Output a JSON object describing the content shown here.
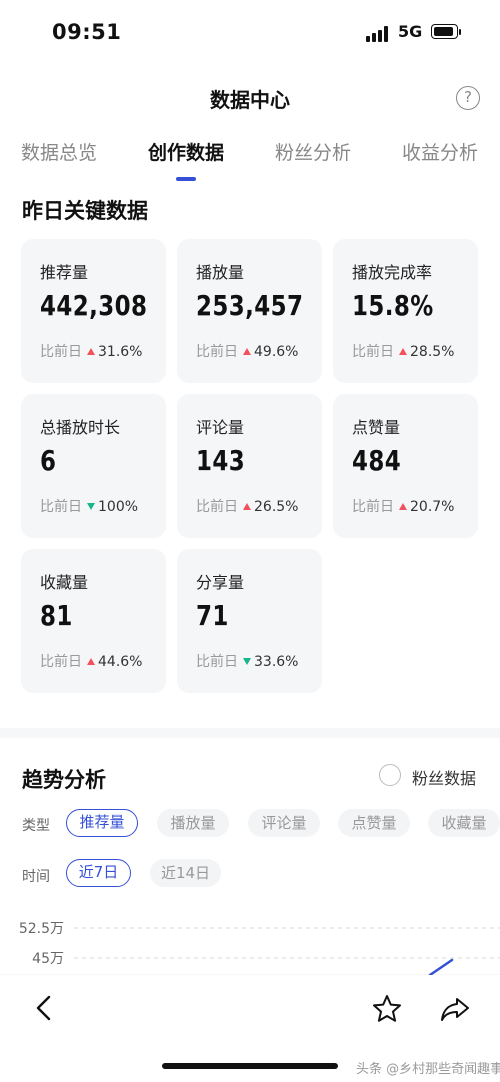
{
  "status_bar": {
    "time": "09:51",
    "network": "5G"
  },
  "header": {
    "title": "数据中心",
    "help_symbol": "?"
  },
  "tabs": [
    {
      "label": "数据总览"
    },
    {
      "label": "创作数据",
      "active": true
    },
    {
      "label": "粉丝分析"
    },
    {
      "label": "收益分析"
    }
  ],
  "section_title": "昨日关键数据",
  "compare_label": "比前日",
  "metrics": [
    {
      "label": "推荐量",
      "value": "442,308",
      "change": "31.6%",
      "direction": "up"
    },
    {
      "label": "播放量",
      "value": "253,457",
      "change": "49.6%",
      "direction": "up"
    },
    {
      "label": "播放完成率",
      "value": "15.8%",
      "change": "28.5%",
      "direction": "up"
    },
    {
      "label": "总播放时长",
      "value": "6",
      "change": "100%",
      "direction": "down"
    },
    {
      "label": "评论量",
      "value": "143",
      "change": "26.5%",
      "direction": "up"
    },
    {
      "label": "点赞量",
      "value": "484",
      "change": "20.7%",
      "direction": "up"
    },
    {
      "label": "收藏量",
      "value": "81",
      "change": "44.6%",
      "direction": "up"
    },
    {
      "label": "分享量",
      "value": "71",
      "change": "33.6%",
      "direction": "down"
    }
  ],
  "trend": {
    "title": "趋势分析",
    "fans_toggle_label": "粉丝数据",
    "type_label": "类型",
    "type_chips": [
      "推荐量",
      "播放量",
      "评论量",
      "点赞量",
      "收藏量"
    ],
    "time_label": "时间",
    "time_chips": [
      "近7日",
      "近14日"
    ]
  },
  "chart_data": {
    "type": "line",
    "y_ticks": [
      "52.5万",
      "45万"
    ],
    "series": [
      {
        "values": []
      }
    ]
  },
  "watermark": "头条 @乡村那些奇闻趣事",
  "colors": {
    "accent": "#3550d6",
    "up": "#f2515b",
    "down": "#17b58c",
    "card_bg": "#f5f6f8"
  },
  "icons": {
    "back": "chevron-left-icon",
    "favorite": "star-icon",
    "share": "share-icon",
    "help": "question-circle-icon"
  }
}
